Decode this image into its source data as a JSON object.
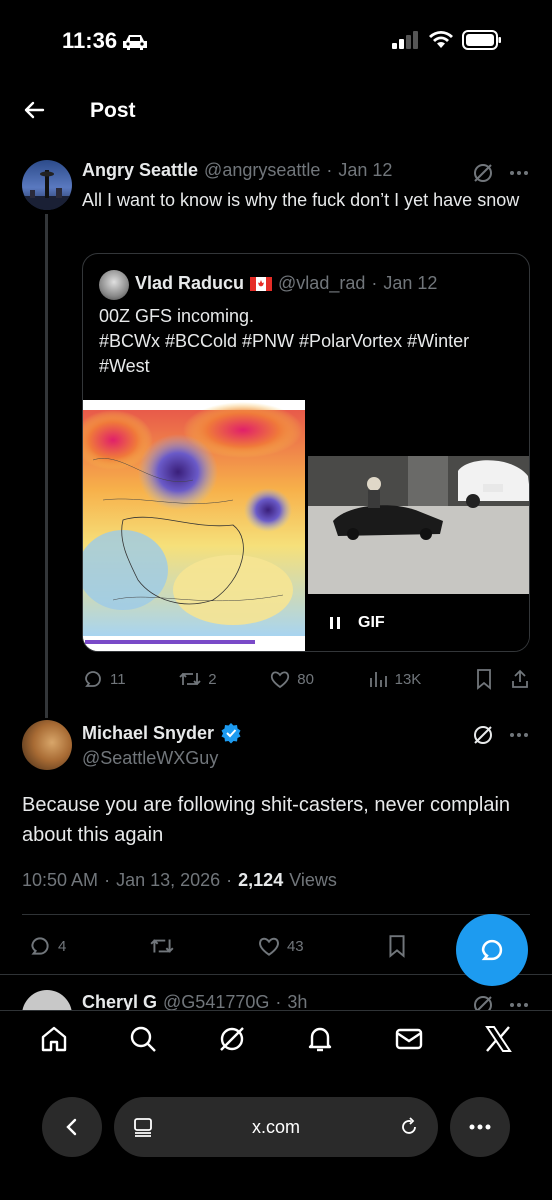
{
  "status_bar": {
    "time": "11:36"
  },
  "header": {
    "title": "Post"
  },
  "tweet1": {
    "name": "Angry Seattle",
    "handle": "@angryseattle",
    "date": "Jan 12",
    "text": "All I want to know is why the fuck don’t I yet have snow",
    "quote": {
      "name": "Vlad Raducu",
      "handle": "@vlad_rad",
      "date": "Jan 12",
      "text_line1": "00Z GFS incoming.",
      "text_line2": "#BCWx #BCCold #PNW #PolarVortex #Winter",
      "text_line3": "#West",
      "gif_label": "GIF"
    },
    "stats": {
      "replies": "11",
      "reposts": "2",
      "likes": "80",
      "views": "13K"
    }
  },
  "tweet2": {
    "name": "Michael Snyder",
    "handle": "@SeattleWXGuy",
    "text": "Because you are following shit-casters, never complain about this again",
    "time": "10:50 AM",
    "date": "Jan 13, 2026",
    "views_count": "2,124",
    "views_label": "Views",
    "stats": {
      "replies": "4",
      "likes": "43"
    }
  },
  "reply_preview": {
    "name": "Cheryl G",
    "handle": "@G541770G",
    "time": "3h"
  },
  "browser": {
    "url": "x.com"
  },
  "colors": {
    "accent": "#1d9bf0",
    "background": "#000000",
    "muted": "#71767b"
  }
}
